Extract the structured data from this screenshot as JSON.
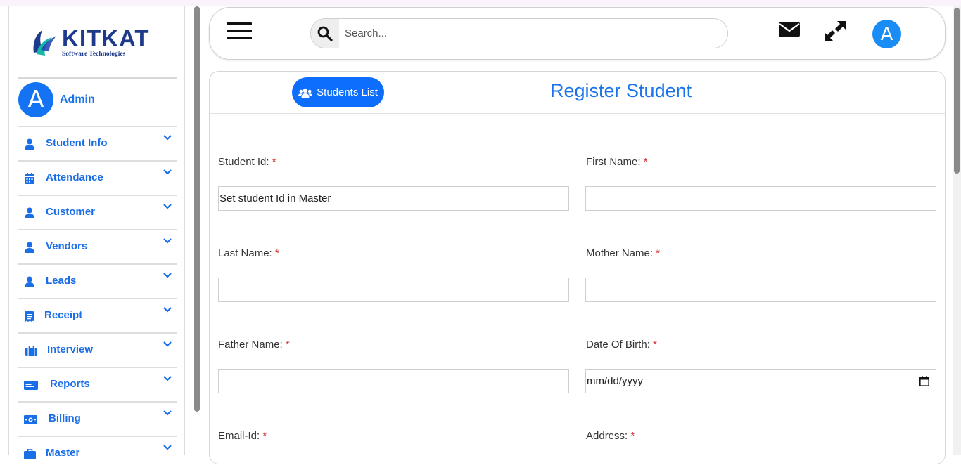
{
  "brand": {
    "name": "KITKAT",
    "tagline": "Software Technologies"
  },
  "user": {
    "initial": "A",
    "name": "Admin"
  },
  "sidebar": {
    "items": [
      {
        "label": "Student Info",
        "icon": "user-icon"
      },
      {
        "label": "Attendance",
        "icon": "calendar-icon"
      },
      {
        "label": "Customer",
        "icon": "user-icon"
      },
      {
        "label": "Vendors",
        "icon": "user-icon"
      },
      {
        "label": "Leads",
        "icon": "user-icon"
      },
      {
        "label": "Receipt",
        "icon": "receipt-icon"
      },
      {
        "label": "Interview",
        "icon": "briefcase-icon"
      },
      {
        "label": "Reports",
        "icon": "id-card-icon"
      },
      {
        "label": "Billing",
        "icon": "money-icon"
      },
      {
        "label": "Master",
        "icon": "briefcase-icon"
      }
    ]
  },
  "header": {
    "search_placeholder": "Search...",
    "avatar_initial": "A"
  },
  "card": {
    "list_button": "Students List",
    "title": "Register Student"
  },
  "form": {
    "student_id": {
      "label": "Student Id:",
      "value": "Set student Id in Master"
    },
    "first_name": {
      "label": "First Name:",
      "value": ""
    },
    "last_name": {
      "label": "Last Name:",
      "value": ""
    },
    "mother_name": {
      "label": "Mother Name:",
      "value": ""
    },
    "father_name": {
      "label": "Father Name:",
      "value": ""
    },
    "dob": {
      "label": "Date Of Birth:",
      "value": "mm/dd/yyyy"
    },
    "email": {
      "label": "Email-Id:"
    },
    "address": {
      "label": "Address:"
    },
    "required_mark": "*"
  },
  "colors": {
    "primary": "#1a73e8",
    "button": "#0d6efd",
    "required": "#d63333"
  }
}
